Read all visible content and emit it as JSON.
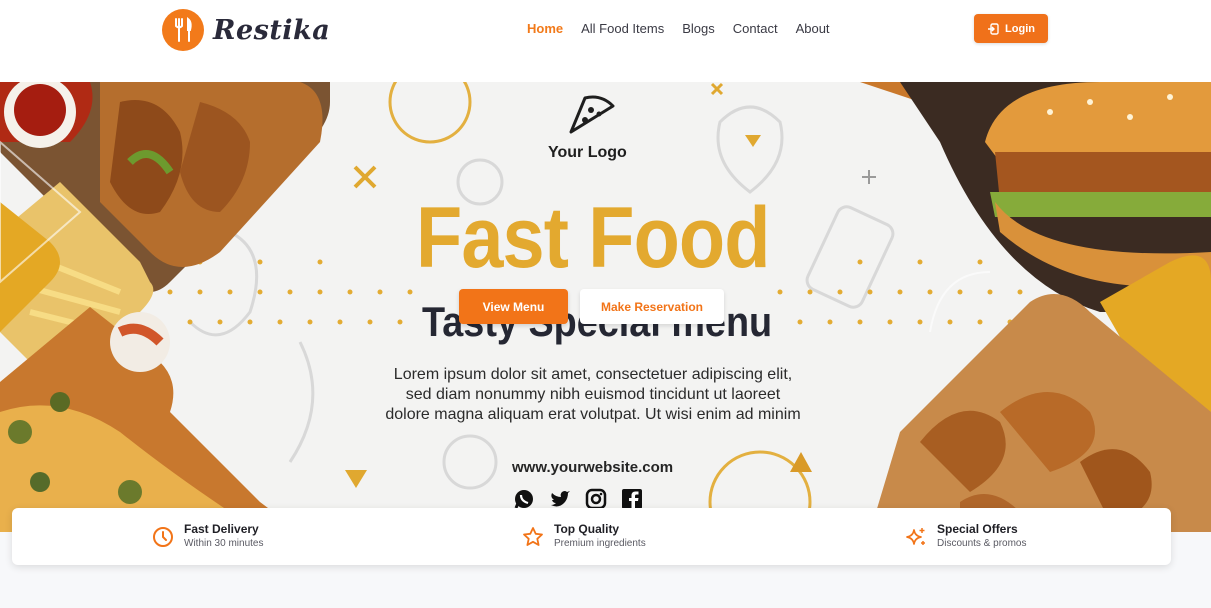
{
  "brand": {
    "name": "Restika",
    "accent": "#f27a1a"
  },
  "nav": {
    "items": [
      {
        "label": "Home",
        "active": true
      },
      {
        "label": "All Food Items",
        "active": false
      },
      {
        "label": "Blogs",
        "active": false
      },
      {
        "label": "Contact",
        "active": false
      },
      {
        "label": "About",
        "active": false
      }
    ],
    "login_label": "Login"
  },
  "hero": {
    "banner_logo_text": "Your Logo",
    "headline": "Fast Food",
    "subheadline": "Tasty Special menu",
    "lorem_lines": [
      "Lorem ipsum dolor sit amet, consectetuer adipiscing elit,",
      "sed diam nonummy nibh euismod tincidunt ut laoreet",
      "dolore magna aliquam erat volutpat. Ut wisi enim ad minim"
    ],
    "website": "www.yourwebsite.com",
    "social_icons": [
      "whatsapp-icon",
      "twitter-icon",
      "instagram-icon",
      "facebook-icon"
    ],
    "view_menu_label": "View Menu",
    "reservation_label": "Make Reservation",
    "colors": {
      "headline": "#e3a92f",
      "button": "#f27418"
    }
  },
  "features": [
    {
      "icon": "clock-icon",
      "title": "Fast Delivery",
      "subtitle": "Within 30 minutes"
    },
    {
      "icon": "star-icon",
      "title": "Top Quality",
      "subtitle": "Premium ingredients"
    },
    {
      "icon": "sparkles-icon",
      "title": "Special Offers",
      "subtitle": "Discounts & promos"
    }
  ]
}
